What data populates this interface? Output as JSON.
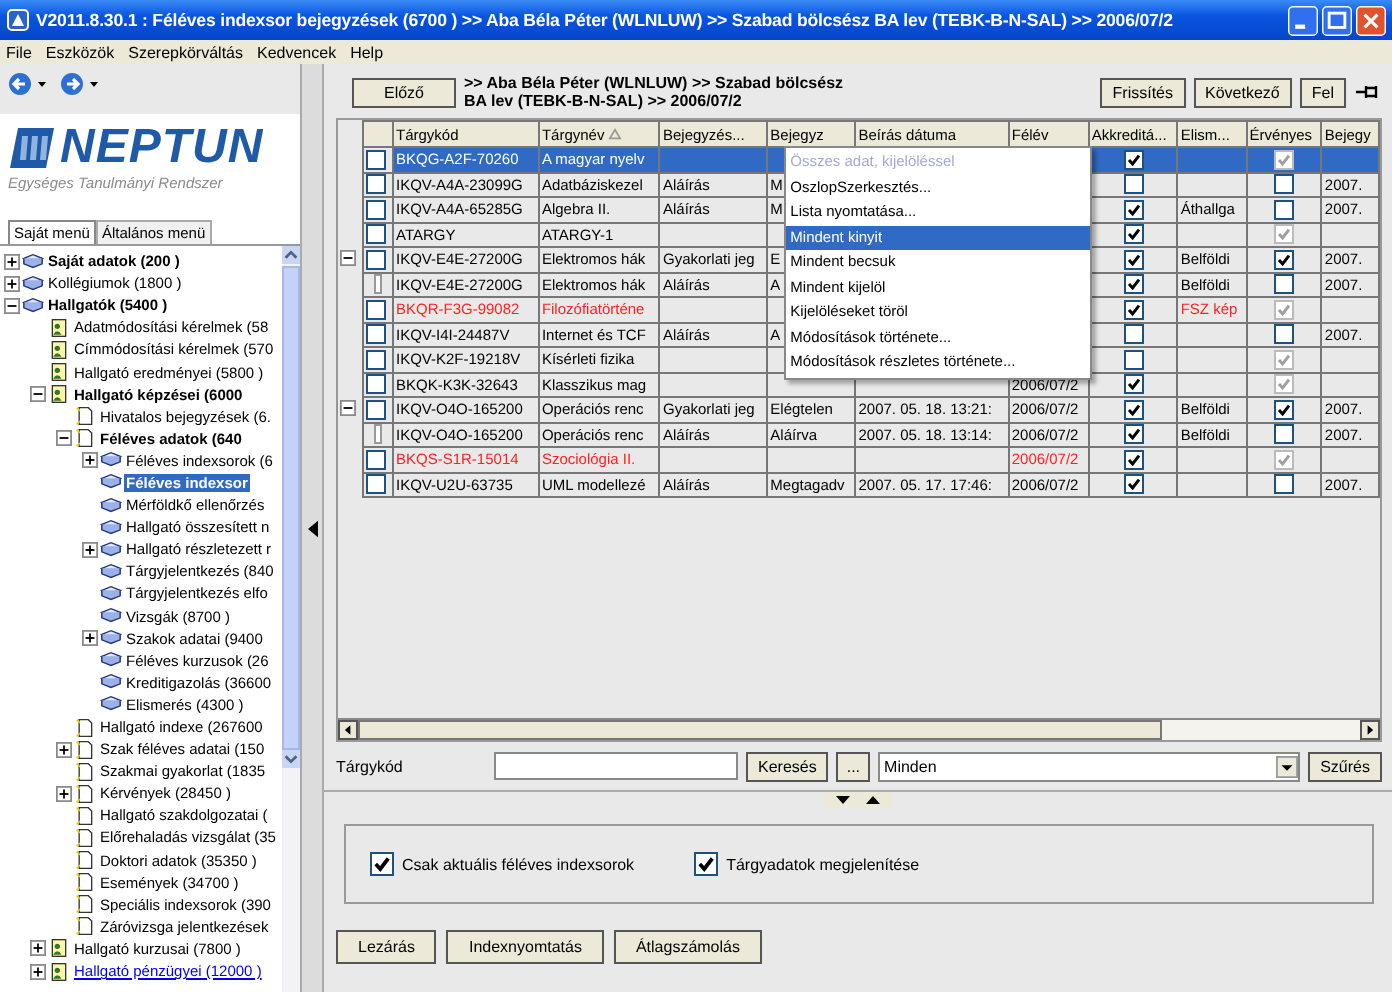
{
  "window": {
    "title": "V2011.8.30.1 : Féléves indexsor bejegyzések (6700  )  >> Aba Béla Péter (WLNLUW) >> Szabad bölcsész BA lev (TEBK-B-N-SAL) >> 2006/07/2"
  },
  "menu": [
    "File",
    "Eszközök",
    "Szerepkörváltás",
    "Kedvencek",
    "Help"
  ],
  "logo": {
    "name": "NEPTUN",
    "subtitle": "Egységes Tanulmányi Rendszer"
  },
  "sidebar": {
    "tabs": [
      {
        "label": "Saját menü",
        "selected": true
      },
      {
        "label": "Általános menü",
        "selected": false
      }
    ],
    "tree": [
      {
        "label": "Saját adatok (200  )",
        "bold": true,
        "kind": "group",
        "expanded": false,
        "selected": false
      },
      {
        "label": "Kollégiumok (1800  )",
        "bold": false,
        "kind": "group",
        "expanded": false,
        "selected": false
      },
      {
        "label": "Hallgatók (5400  )",
        "bold": true,
        "kind": "group",
        "expanded": true,
        "selected": false,
        "children": [
          {
            "label": "Adatmódosítási kérelmek (58",
            "bold": false,
            "kind": "record",
            "selected": false
          },
          {
            "label": "Címmódosítási kérelmek (570",
            "bold": false,
            "kind": "record",
            "selected": false
          },
          {
            "label": "Hallgató eredményei (5800  )",
            "bold": false,
            "kind": "record",
            "selected": false
          },
          {
            "label": "Hallgató képzései (6000",
            "bold": true,
            "kind": "record",
            "expanded": true,
            "selected": false,
            "children": [
              {
                "label": "Hivatalos bejegyzések (6.",
                "bold": false,
                "kind": "view",
                "selected": false
              },
              {
                "label": "Féléves adatok (640",
                "bold": true,
                "kind": "view",
                "expanded": true,
                "selected": false,
                "children": [
                  {
                    "label": "Féléves indexsorok (6",
                    "bold": false,
                    "kind": "group",
                    "expanded": false,
                    "selected": false
                  },
                  {
                    "label": "Féléves indexsor",
                    "bold": true,
                    "kind": "group",
                    "selected": true
                  },
                  {
                    "label": "Mérföldkő ellenőrzés",
                    "bold": false,
                    "kind": "group",
                    "selected": false
                  },
                  {
                    "label": "Hallgató összesített n",
                    "bold": false,
                    "kind": "group",
                    "selected": false
                  },
                  {
                    "label": "Hallgató részletezett r",
                    "bold": false,
                    "kind": "group",
                    "expanded": false,
                    "selected": false
                  },
                  {
                    "label": "Tárgyjelentkezés (840",
                    "bold": false,
                    "kind": "group",
                    "selected": false
                  },
                  {
                    "label": "Tárgyjelentkezés elfo",
                    "bold": false,
                    "kind": "group",
                    "selected": false
                  },
                  {
                    "label": "Vizsgák (8700  )",
                    "bold": false,
                    "kind": "group",
                    "selected": false
                  },
                  {
                    "label": "Szakok adatai (9400",
                    "bold": false,
                    "kind": "group",
                    "expanded": false,
                    "selected": false
                  },
                  {
                    "label": "Féléves kurzusok (26",
                    "bold": false,
                    "kind": "group",
                    "selected": false
                  },
                  {
                    "label": "Kreditigazolás (36600",
                    "bold": false,
                    "kind": "group",
                    "selected": false
                  },
                  {
                    "label": "Elismerés (4300  )",
                    "bold": false,
                    "kind": "group",
                    "selected": false
                  }
                ]
              },
              {
                "label": "Hallgató indexe (267600",
                "bold": false,
                "kind": "view",
                "selected": false
              },
              {
                "label": "Szak féléves adatai (150",
                "bold": false,
                "kind": "view",
                "expanded": false,
                "selected": false
              },
              {
                "label": "Szakmai gyakorlat (1835",
                "bold": false,
                "kind": "view",
                "selected": false
              },
              {
                "label": "Kérvények (28450  )",
                "bold": false,
                "kind": "view",
                "expanded": false,
                "selected": false
              },
              {
                "label": "Hallgató szakdolgozatai (",
                "bold": false,
                "kind": "view",
                "selected": false
              },
              {
                "label": "Előrehaladás vizsgálat (35",
                "bold": false,
                "kind": "view",
                "selected": false
              },
              {
                "label": "Doktori adatok (35350  )",
                "bold": false,
                "kind": "view",
                "selected": false
              },
              {
                "label": "Események (34700  )",
                "bold": false,
                "kind": "view",
                "selected": false
              },
              {
                "label": "Speciális indexsorok (390",
                "bold": false,
                "kind": "view",
                "selected": false
              },
              {
                "label": "Záróvizsga jelentkezések",
                "bold": false,
                "kind": "view",
                "selected": false
              }
            ]
          },
          {
            "label": "Hallgató kurzusai (7800  )",
            "bold": false,
            "kind": "record",
            "expanded": false,
            "selected": false
          },
          {
            "label": "Hallgató pénzügyei (12000  )",
            "bold": false,
            "kind": "record",
            "expanded": false,
            "selected": false,
            "hover": true
          }
        ]
      }
    ]
  },
  "header": {
    "prev": "Előző",
    "breadcrumb": ">> Aba Béla Péter (WLNLUW) >> Szabad bölcsész BA lev (TEBK-B-N-SAL) >> 2006/07/2",
    "buttons": [
      "Frissítés",
      "Következő",
      "Fel"
    ]
  },
  "table": {
    "columns": [
      {
        "label": "Tárgykód",
        "sorted": false
      },
      {
        "label": "Tárgynév",
        "sorted": true
      },
      {
        "label": "Bejegyzés...",
        "sorted": false
      },
      {
        "label": "Bejegyz",
        "sorted": false
      },
      {
        "label": "Beírás dátuma",
        "sorted": false
      },
      {
        "label": "Félév",
        "sorted": false
      },
      {
        "label": "Akkreditá...",
        "sorted": false
      },
      {
        "label": "Elism...",
        "sorted": false
      },
      {
        "label": "Érvényes",
        "sorted": false
      },
      {
        "label": "Bejegy",
        "sorted": false
      }
    ],
    "rows": [
      {
        "kind": "plain",
        "selected": true,
        "checked": false,
        "flagged": false,
        "cells": [
          "BKQG-A2F-70260",
          "A magyar nyelv",
          "",
          "",
          "",
          "",
          "",
          "",
          "",
          ""
        ],
        "accredited": true,
        "valid": true,
        "valid_locked": true
      },
      {
        "kind": "plain",
        "selected": false,
        "checked": false,
        "flagged": false,
        "cells": [
          "IKQV-A4A-23099G",
          "Adatbáziskezel",
          "Aláírás",
          "M",
          "",
          "",
          "",
          "",
          "",
          "2007."
        ],
        "accredited": false,
        "valid": false,
        "valid_locked": false
      },
      {
        "kind": "plain",
        "selected": false,
        "checked": false,
        "flagged": false,
        "cells": [
          "IKQV-A4A-65285G",
          "Algebra II.",
          "Aláírás",
          "M",
          "",
          "",
          "",
          "Áthallga",
          "",
          "2007."
        ],
        "accredited": true,
        "valid": false,
        "valid_locked": false
      },
      {
        "kind": "plain",
        "selected": false,
        "checked": false,
        "flagged": false,
        "cells": [
          "ATARGY",
          "ATARGY-1",
          "",
          "",
          "",
          "",
          "",
          "",
          "",
          ""
        ],
        "accredited": true,
        "valid": true,
        "valid_locked": true
      },
      {
        "kind": "parent",
        "expanded": true,
        "selected": false,
        "checked": false,
        "flagged": false,
        "cells": [
          "IKQV-E4E-27200G",
          "Elektromos hák",
          "Gyakorlati jeg",
          "E",
          "",
          "",
          "",
          "Belföldi",
          "",
          "2007."
        ],
        "accredited": true,
        "valid": true,
        "valid_locked": false
      },
      {
        "kind": "child",
        "selected": false,
        "checked": false,
        "flagged": false,
        "cells": [
          "IKQV-E4E-27200G",
          "Elektromos hák",
          "Aláírás",
          "A",
          "",
          "",
          "",
          "Belföldi",
          "",
          "2007."
        ],
        "accredited": true,
        "valid": false,
        "valid_locked": false
      },
      {
        "kind": "plain",
        "selected": false,
        "checked": false,
        "flagged": true,
        "cells": [
          "BKQR-F3G-99082",
          "Filozófiatörténe",
          "",
          "",
          "",
          "",
          "",
          "FSZ kép",
          "",
          ""
        ],
        "accredited": true,
        "valid": true,
        "valid_locked": true
      },
      {
        "kind": "plain",
        "selected": false,
        "checked": false,
        "flagged": false,
        "cells": [
          "IKQV-I4I-24487V",
          "Internet és TCF",
          "Aláírás",
          "A",
          "",
          "",
          "",
          "",
          "",
          "2007."
        ],
        "accredited": false,
        "valid": false,
        "valid_locked": false
      },
      {
        "kind": "plain",
        "selected": false,
        "checked": false,
        "flagged": false,
        "cells": [
          "IKQV-K2F-19218V",
          "Kísérleti fizika",
          "",
          "",
          "",
          "",
          "",
          "",
          "",
          ""
        ],
        "accredited": false,
        "valid": true,
        "valid_locked": true
      },
      {
        "kind": "plain",
        "selected": false,
        "checked": false,
        "flagged": false,
        "cells": [
          "BKQK-K3K-32643",
          "Klasszikus mag",
          "",
          "",
          "",
          "2006/07/2",
          "",
          "",
          "",
          ""
        ],
        "accredited": true,
        "valid": true,
        "valid_locked": true
      },
      {
        "kind": "parent",
        "expanded": true,
        "selected": false,
        "checked": false,
        "flagged": false,
        "cells": [
          "IKQV-O4O-165200",
          "Operációs renc",
          "Gyakorlati jeg",
          "Elégtelen",
          "2007. 05. 18. 13:21:",
          "2006/07/2",
          "",
          "Belföldi",
          "",
          "2007."
        ],
        "accredited": true,
        "valid": true,
        "valid_locked": false
      },
      {
        "kind": "child",
        "selected": false,
        "checked": false,
        "flagged": false,
        "cells": [
          "IKQV-O4O-165200",
          "Operációs renc",
          "Aláírás",
          "Aláírva",
          "2007. 05. 18. 13:14:",
          "2006/07/2",
          "",
          "Belföldi",
          "",
          "2007."
        ],
        "accredited": true,
        "valid": false,
        "valid_locked": false
      },
      {
        "kind": "plain",
        "selected": false,
        "checked": false,
        "flagged": true,
        "cells": [
          "BKQS-S1R-15014",
          "Szociológia II.",
          "",
          "",
          "",
          "2006/07/2",
          "",
          "",
          "",
          ""
        ],
        "accredited": true,
        "valid": true,
        "valid_locked": true
      },
      {
        "kind": "plain",
        "selected": false,
        "checked": false,
        "flagged": false,
        "cells": [
          "IKQV-U2U-63735",
          "UML modellezé",
          "Aláírás",
          "Megtagadv",
          "2007. 05. 17. 17:46:",
          "2006/07/2",
          "",
          "",
          "",
          "2007."
        ],
        "accredited": true,
        "valid": false,
        "valid_locked": false
      }
    ]
  },
  "context_menu": {
    "items": [
      {
        "label": "Összes adat, kijelöléssel",
        "disabled": true,
        "selected": false
      },
      {
        "label": "OszlopSzerkesztés...",
        "disabled": false,
        "selected": false
      },
      {
        "label": "Lista nyomtatása...",
        "disabled": false,
        "selected": false
      },
      {
        "label": "Mindent kinyit",
        "disabled": false,
        "selected": true
      },
      {
        "label": "Mindent becsuk",
        "disabled": false,
        "selected": false
      },
      {
        "label": "Mindent kijelöl",
        "disabled": false,
        "selected": false
      },
      {
        "label": "Kijelöléseket töröl",
        "disabled": false,
        "selected": false
      },
      {
        "label": "Módosítások története...",
        "disabled": false,
        "selected": false
      },
      {
        "label": "Módosítások részletes története...",
        "disabled": false,
        "selected": false
      }
    ]
  },
  "search": {
    "label": "Tárgykód",
    "button": "Keresés",
    "more": "...",
    "filter": "Minden",
    "filter_button": "Szűrés"
  },
  "options": [
    {
      "label": "Csak aktuális féléves indexsorok",
      "checked": true
    },
    {
      "label": "Tárgyadatok megjelenítése",
      "checked": true
    }
  ],
  "actions": [
    "Lezárás",
    "Indexnyomtatás",
    "Átlagszámolás"
  ]
}
